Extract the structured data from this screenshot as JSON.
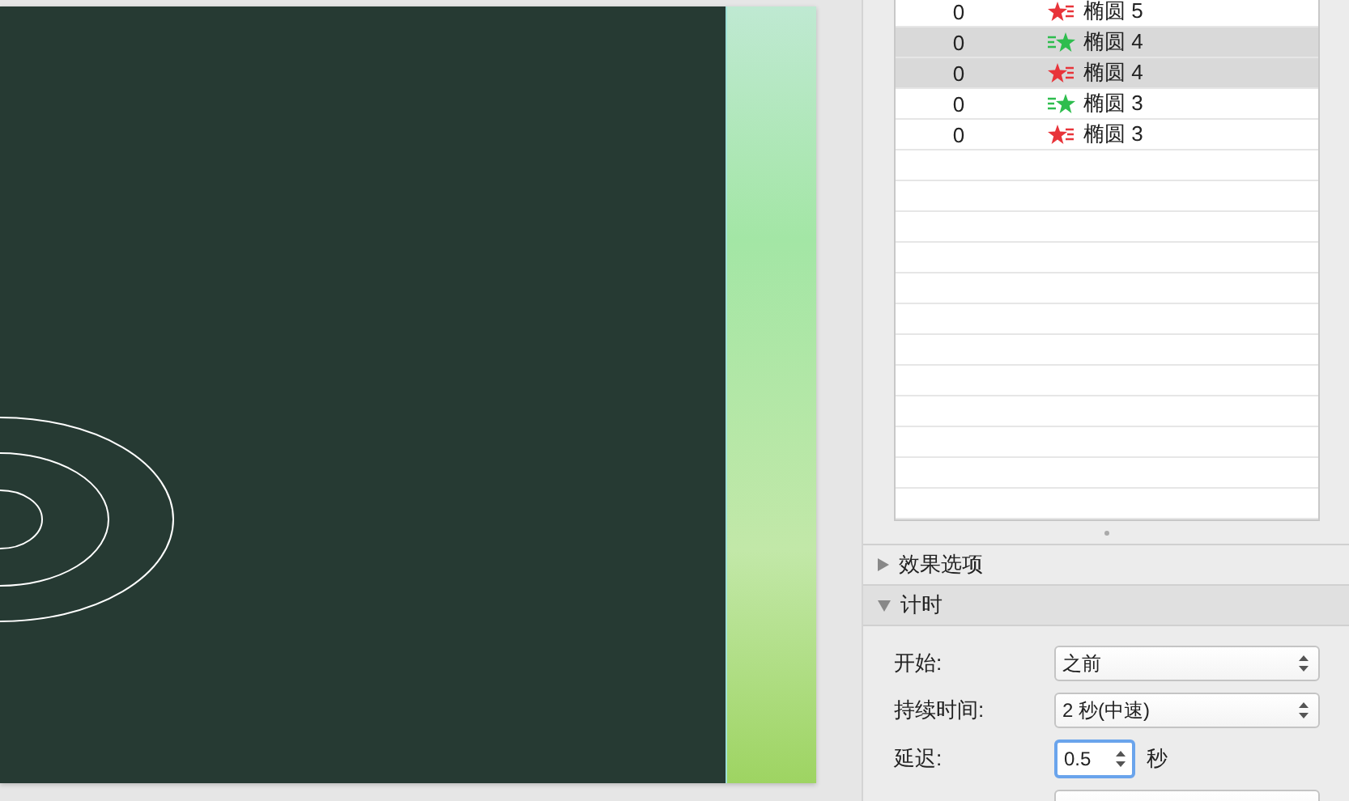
{
  "animation_list": {
    "rows": [
      {
        "number": "0",
        "kind": "exit",
        "name": "椭圆 5",
        "selected": false
      },
      {
        "number": "0",
        "kind": "entrance",
        "name": "椭圆 4",
        "selected": true
      },
      {
        "number": "0",
        "kind": "exit",
        "name": "椭圆 4",
        "selected": true
      },
      {
        "number": "0",
        "kind": "entrance",
        "name": "椭圆 3",
        "selected": false
      },
      {
        "number": "0",
        "kind": "exit",
        "name": "椭圆 3",
        "selected": false
      }
    ]
  },
  "sections": [
    {
      "title": "效果选项",
      "expanded": false
    },
    {
      "title": "计时",
      "expanded": true
    }
  ],
  "timing": {
    "start": {
      "label": "开始:",
      "value": "之前"
    },
    "duration": {
      "label": "持续时间:",
      "value": "2 秒(中速)"
    },
    "delay": {
      "label": "延迟:",
      "value": "0.5",
      "unit": "秒"
    }
  }
}
